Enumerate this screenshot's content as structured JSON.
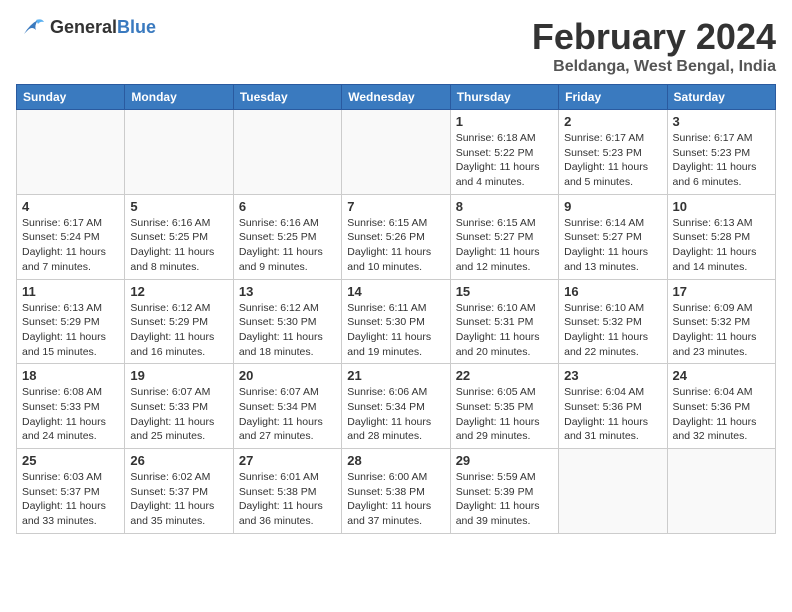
{
  "header": {
    "logo_line1": "General",
    "logo_line2": "Blue",
    "month_year": "February 2024",
    "location": "Beldanga, West Bengal, India"
  },
  "weekdays": [
    "Sunday",
    "Monday",
    "Tuesday",
    "Wednesday",
    "Thursday",
    "Friday",
    "Saturday"
  ],
  "weeks": [
    [
      {
        "day": "",
        "sunrise": "",
        "sunset": "",
        "daylight": ""
      },
      {
        "day": "",
        "sunrise": "",
        "sunset": "",
        "daylight": ""
      },
      {
        "day": "",
        "sunrise": "",
        "sunset": "",
        "daylight": ""
      },
      {
        "day": "",
        "sunrise": "",
        "sunset": "",
        "daylight": ""
      },
      {
        "day": "1",
        "sunrise": "Sunrise: 6:18 AM",
        "sunset": "Sunset: 5:22 PM",
        "daylight": "Daylight: 11 hours and 4 minutes."
      },
      {
        "day": "2",
        "sunrise": "Sunrise: 6:17 AM",
        "sunset": "Sunset: 5:23 PM",
        "daylight": "Daylight: 11 hours and 5 minutes."
      },
      {
        "day": "3",
        "sunrise": "Sunrise: 6:17 AM",
        "sunset": "Sunset: 5:23 PM",
        "daylight": "Daylight: 11 hours and 6 minutes."
      }
    ],
    [
      {
        "day": "4",
        "sunrise": "Sunrise: 6:17 AM",
        "sunset": "Sunset: 5:24 PM",
        "daylight": "Daylight: 11 hours and 7 minutes."
      },
      {
        "day": "5",
        "sunrise": "Sunrise: 6:16 AM",
        "sunset": "Sunset: 5:25 PM",
        "daylight": "Daylight: 11 hours and 8 minutes."
      },
      {
        "day": "6",
        "sunrise": "Sunrise: 6:16 AM",
        "sunset": "Sunset: 5:25 PM",
        "daylight": "Daylight: 11 hours and 9 minutes."
      },
      {
        "day": "7",
        "sunrise": "Sunrise: 6:15 AM",
        "sunset": "Sunset: 5:26 PM",
        "daylight": "Daylight: 11 hours and 10 minutes."
      },
      {
        "day": "8",
        "sunrise": "Sunrise: 6:15 AM",
        "sunset": "Sunset: 5:27 PM",
        "daylight": "Daylight: 11 hours and 12 minutes."
      },
      {
        "day": "9",
        "sunrise": "Sunrise: 6:14 AM",
        "sunset": "Sunset: 5:27 PM",
        "daylight": "Daylight: 11 hours and 13 minutes."
      },
      {
        "day": "10",
        "sunrise": "Sunrise: 6:13 AM",
        "sunset": "Sunset: 5:28 PM",
        "daylight": "Daylight: 11 hours and 14 minutes."
      }
    ],
    [
      {
        "day": "11",
        "sunrise": "Sunrise: 6:13 AM",
        "sunset": "Sunset: 5:29 PM",
        "daylight": "Daylight: 11 hours and 15 minutes."
      },
      {
        "day": "12",
        "sunrise": "Sunrise: 6:12 AM",
        "sunset": "Sunset: 5:29 PM",
        "daylight": "Daylight: 11 hours and 16 minutes."
      },
      {
        "day": "13",
        "sunrise": "Sunrise: 6:12 AM",
        "sunset": "Sunset: 5:30 PM",
        "daylight": "Daylight: 11 hours and 18 minutes."
      },
      {
        "day": "14",
        "sunrise": "Sunrise: 6:11 AM",
        "sunset": "Sunset: 5:30 PM",
        "daylight": "Daylight: 11 hours and 19 minutes."
      },
      {
        "day": "15",
        "sunrise": "Sunrise: 6:10 AM",
        "sunset": "Sunset: 5:31 PM",
        "daylight": "Daylight: 11 hours and 20 minutes."
      },
      {
        "day": "16",
        "sunrise": "Sunrise: 6:10 AM",
        "sunset": "Sunset: 5:32 PM",
        "daylight": "Daylight: 11 hours and 22 minutes."
      },
      {
        "day": "17",
        "sunrise": "Sunrise: 6:09 AM",
        "sunset": "Sunset: 5:32 PM",
        "daylight": "Daylight: 11 hours and 23 minutes."
      }
    ],
    [
      {
        "day": "18",
        "sunrise": "Sunrise: 6:08 AM",
        "sunset": "Sunset: 5:33 PM",
        "daylight": "Daylight: 11 hours and 24 minutes."
      },
      {
        "day": "19",
        "sunrise": "Sunrise: 6:07 AM",
        "sunset": "Sunset: 5:33 PM",
        "daylight": "Daylight: 11 hours and 25 minutes."
      },
      {
        "day": "20",
        "sunrise": "Sunrise: 6:07 AM",
        "sunset": "Sunset: 5:34 PM",
        "daylight": "Daylight: 11 hours and 27 minutes."
      },
      {
        "day": "21",
        "sunrise": "Sunrise: 6:06 AM",
        "sunset": "Sunset: 5:34 PM",
        "daylight": "Daylight: 11 hours and 28 minutes."
      },
      {
        "day": "22",
        "sunrise": "Sunrise: 6:05 AM",
        "sunset": "Sunset: 5:35 PM",
        "daylight": "Daylight: 11 hours and 29 minutes."
      },
      {
        "day": "23",
        "sunrise": "Sunrise: 6:04 AM",
        "sunset": "Sunset: 5:36 PM",
        "daylight": "Daylight: 11 hours and 31 minutes."
      },
      {
        "day": "24",
        "sunrise": "Sunrise: 6:04 AM",
        "sunset": "Sunset: 5:36 PM",
        "daylight": "Daylight: 11 hours and 32 minutes."
      }
    ],
    [
      {
        "day": "25",
        "sunrise": "Sunrise: 6:03 AM",
        "sunset": "Sunset: 5:37 PM",
        "daylight": "Daylight: 11 hours and 33 minutes."
      },
      {
        "day": "26",
        "sunrise": "Sunrise: 6:02 AM",
        "sunset": "Sunset: 5:37 PM",
        "daylight": "Daylight: 11 hours and 35 minutes."
      },
      {
        "day": "27",
        "sunrise": "Sunrise: 6:01 AM",
        "sunset": "Sunset: 5:38 PM",
        "daylight": "Daylight: 11 hours and 36 minutes."
      },
      {
        "day": "28",
        "sunrise": "Sunrise: 6:00 AM",
        "sunset": "Sunset: 5:38 PM",
        "daylight": "Daylight: 11 hours and 37 minutes."
      },
      {
        "day": "29",
        "sunrise": "Sunrise: 5:59 AM",
        "sunset": "Sunset: 5:39 PM",
        "daylight": "Daylight: 11 hours and 39 minutes."
      },
      {
        "day": "",
        "sunrise": "",
        "sunset": "",
        "daylight": ""
      },
      {
        "day": "",
        "sunrise": "",
        "sunset": "",
        "daylight": ""
      }
    ]
  ]
}
